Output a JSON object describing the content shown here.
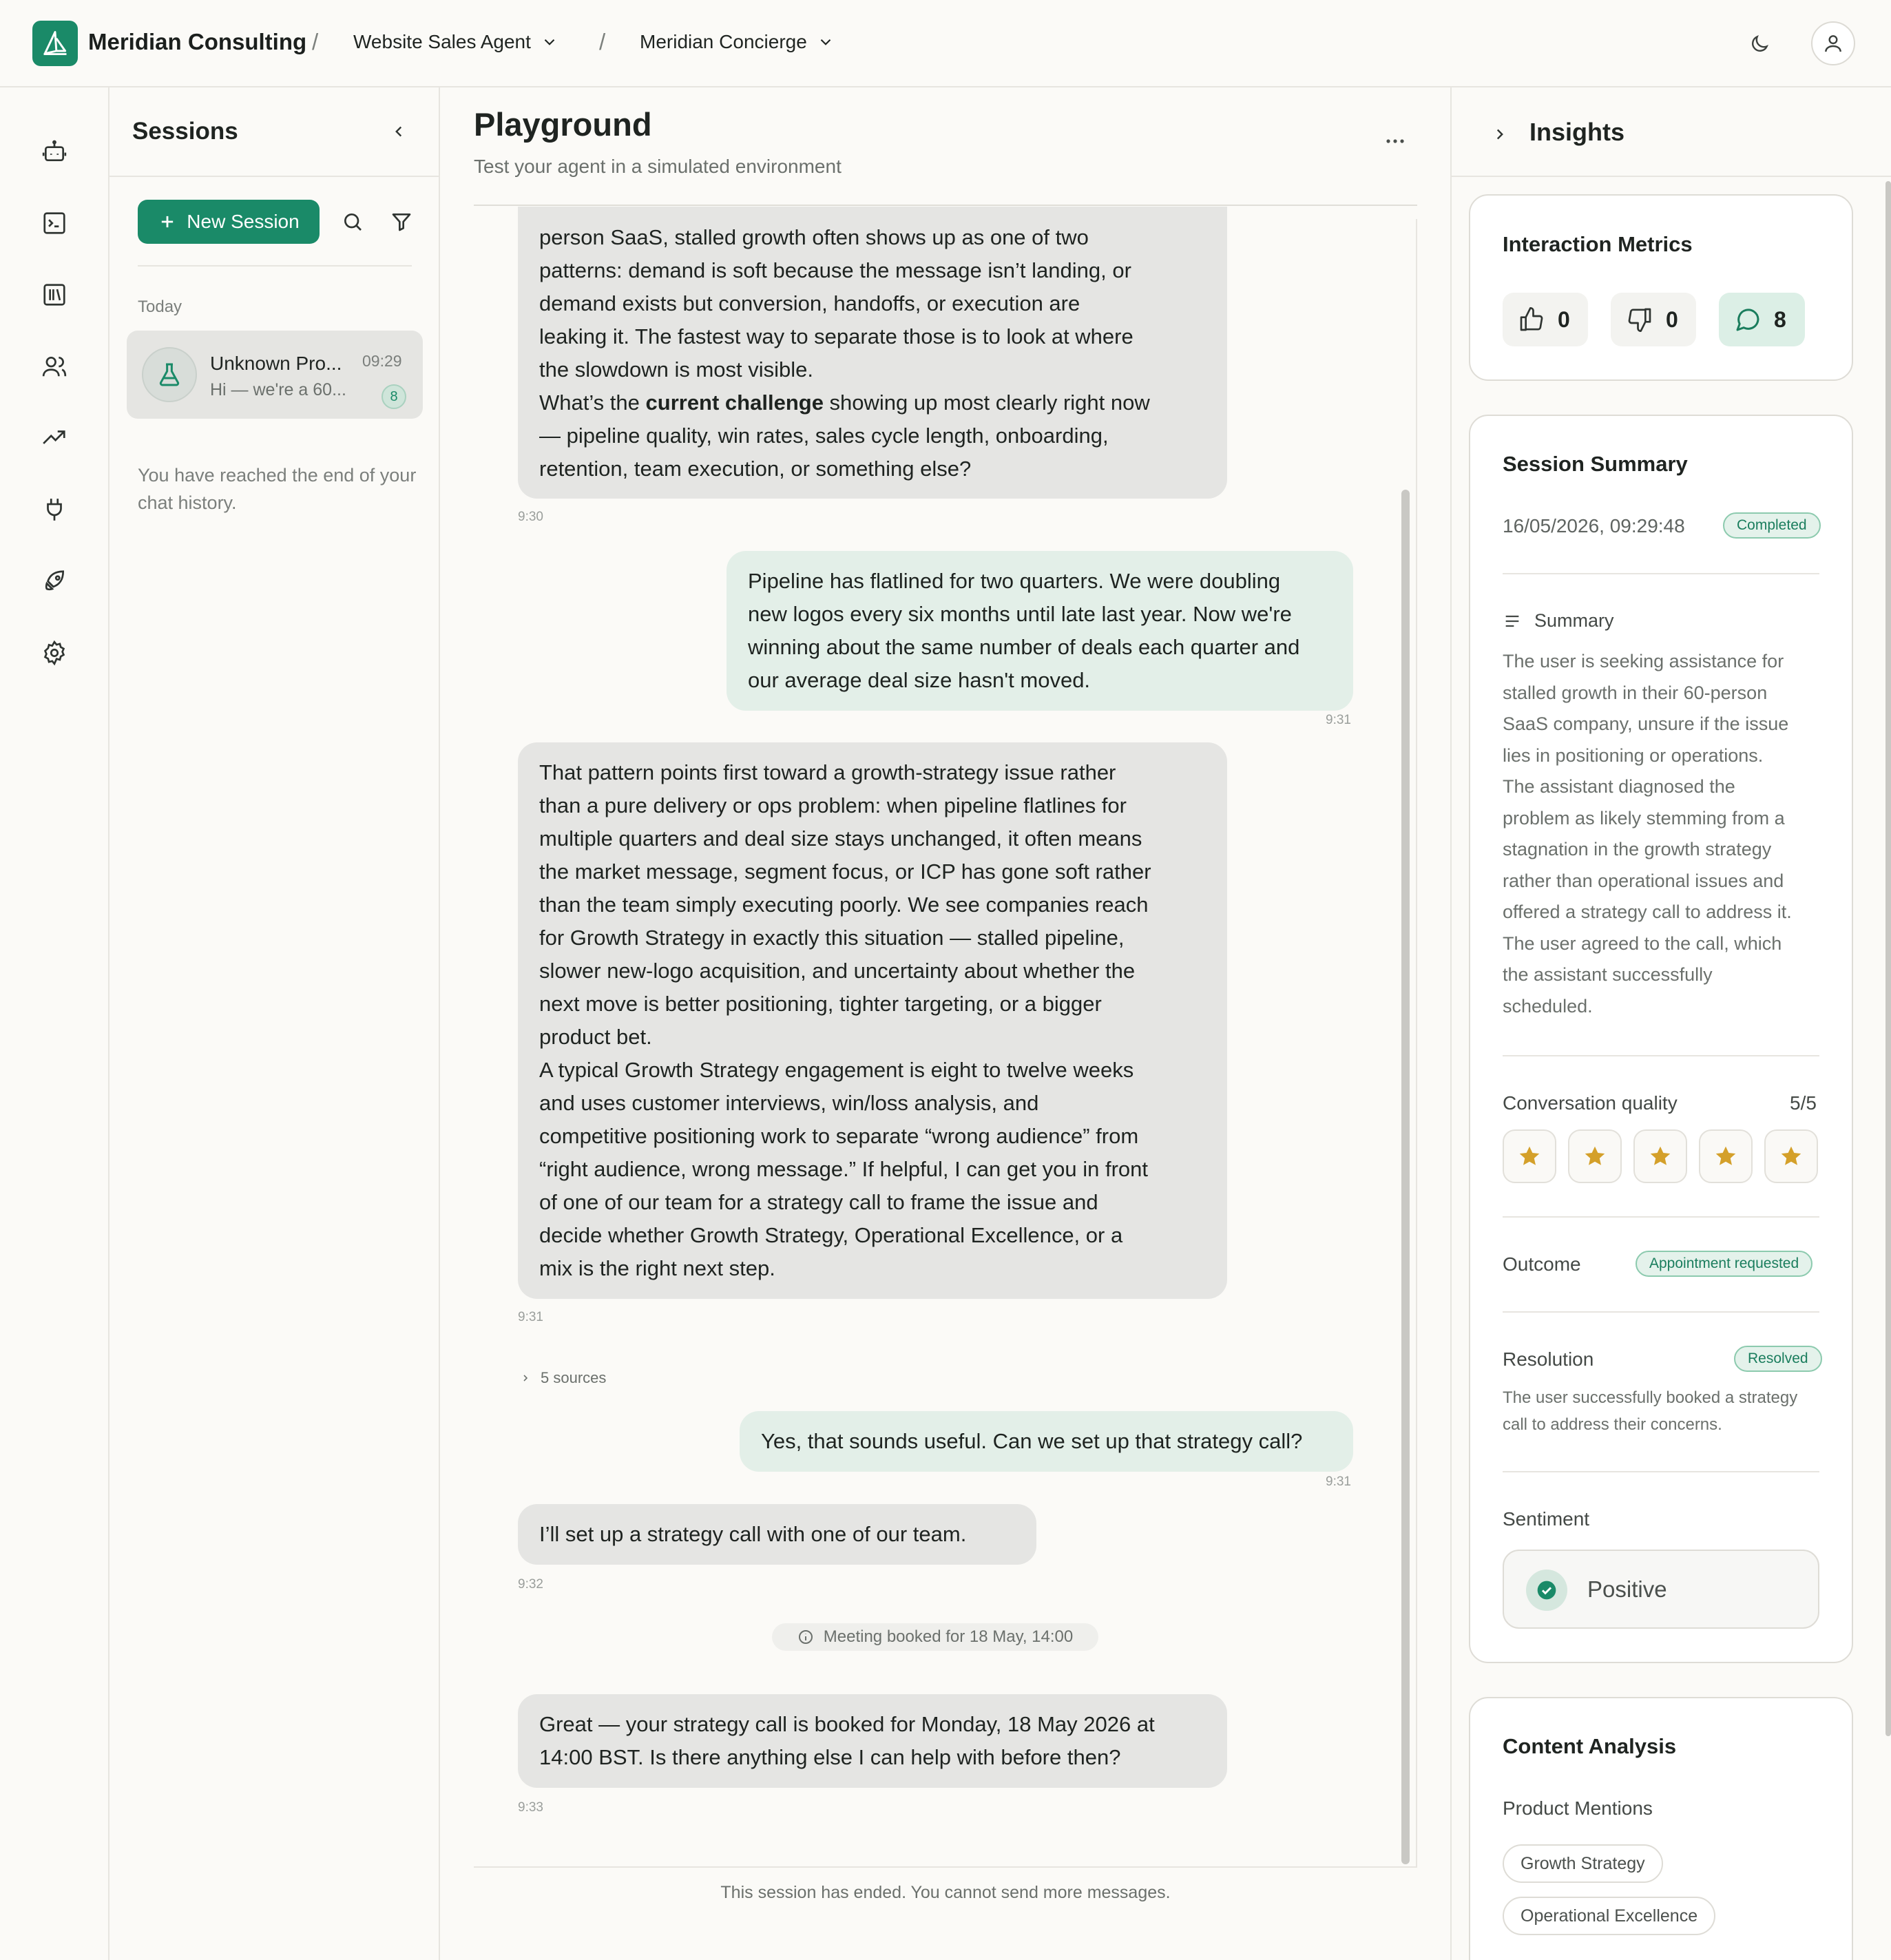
{
  "header": {
    "org_name": "Meridian Consulting",
    "separator": "/",
    "agent": "Website Sales Agent",
    "persona": "Meridian Concierge"
  },
  "sessions": {
    "title": "Sessions",
    "new_session_label": "New Session",
    "group_label": "Today",
    "items": [
      {
        "name": "Unknown Pro...",
        "preview": "Hi — we're a 60...",
        "time": "09:29",
        "count": "8"
      }
    ],
    "end_note": "You have reached the end of your chat history."
  },
  "main": {
    "title": "Playground",
    "subtitle": "Test your agent in a simulated environment",
    "ended_note": "This session has ended. You cannot send more messages.",
    "sources_label": "5 sources",
    "event_label": "Meeting booked for 18 May, 14:00",
    "messages": [
      {
        "role": "assistant",
        "lines": [
          "person SaaS, stalled growth often shows up as one of two",
          "patterns: demand is soft because the message isn’t landing, or",
          "demand exists but conversion, handoffs, or execution are",
          "leaking it. The fastest way to separate those is to look at where",
          "the slowdown is most visible."
        ],
        "q_prefix": "What’s the ",
        "q_bold": "current challenge",
        "q_suffix": " showing up most clearly right now",
        "q_line2": "— pipeline quality, win rates, sales cycle length, onboarding,",
        "q_line3": "retention, team execution, or something else?",
        "time": "9:30"
      },
      {
        "role": "user",
        "lines": [
          "Pipeline has flatlined for two quarters. We were doubling",
          "new logos every six months until late last year. Now we're",
          "winning about the same number of deals each quarter and",
          "our average deal size hasn't moved."
        ],
        "time": "9:31"
      },
      {
        "role": "assistant",
        "lines": [
          "That pattern points first toward a growth-strategy issue rather",
          "than a pure delivery or ops problem: when pipeline flatlines for",
          "multiple quarters and deal size stays unchanged, it often means",
          "the market message, segment focus, or ICP has gone soft rather",
          "than the team simply executing poorly. We see companies reach",
          "for Growth Strategy in exactly this situation — stalled pipeline,",
          "slower new-logo acquisition, and uncertainty about whether the",
          "next move is better positioning, tighter targeting, or a bigger",
          "product bet.",
          "A typical Growth Strategy engagement is eight to twelve weeks",
          "and uses customer interviews, win/loss analysis, and",
          "competitive positioning work to separate “wrong audience” from",
          "“right audience, wrong message.” If helpful, I can get you in front",
          "of one of our team for a strategy call to frame the issue and",
          "decide whether Growth Strategy, Operational Excellence, or a",
          "mix is the right next step."
        ],
        "time": "9:31"
      },
      {
        "role": "user",
        "lines": [
          "Yes, that sounds useful. Can we set up that strategy call?"
        ],
        "time": "9:31"
      },
      {
        "role": "assistant",
        "lines": [
          "I’ll set up a strategy call with one of our team."
        ],
        "time": "9:32"
      },
      {
        "role": "assistant",
        "lines": [
          "Great — your strategy call is booked for Monday, 18 May 2026 at",
          "14:00 BST. Is there anything else I can help with before then?"
        ],
        "time": "9:33"
      }
    ]
  },
  "insights": {
    "title": "Insights",
    "metrics": {
      "title": "Interaction Metrics",
      "thumbs_up": "0",
      "thumbs_down": "0",
      "messages": "8"
    },
    "summary_card": {
      "title": "Session Summary",
      "datetime": "16/05/2026, 09:29:48",
      "status": "Completed",
      "summary_label": "Summary",
      "summary_lines": [
        "The user is seeking assistance for",
        "stalled growth in their 60-person",
        "SaaS company, unsure if the issue",
        "lies in positioning or operations.",
        "The assistant diagnosed the",
        "problem as likely stemming from a",
        "stagnation in the growth strategy",
        "rather than operational issues and",
        "offered a strategy call to address it.",
        "The user agreed to the call, which",
        "the assistant successfully",
        "scheduled."
      ],
      "quality_label": "Conversation quality",
      "quality_value": "5/5",
      "quality_stars": 5,
      "outcome_label": "Outcome",
      "outcome_value": "Appointment requested",
      "resolution_label": "Resolution",
      "resolution_value": "Resolved",
      "resolution_lines": [
        "The user successfully booked a strategy",
        "call to address their concerns."
      ],
      "sentiment_label": "Sentiment",
      "sentiment_value": "Positive"
    },
    "content": {
      "title": "Content Analysis",
      "product_label": "Product Mentions",
      "products": [
        "Growth Strategy",
        "Operational Excellence"
      ]
    }
  },
  "colors": {
    "accent": "#1a8a68",
    "user_bubble": "#e3efe8",
    "bot_bubble": "#e5e5e3",
    "star": "#d4a02a"
  }
}
